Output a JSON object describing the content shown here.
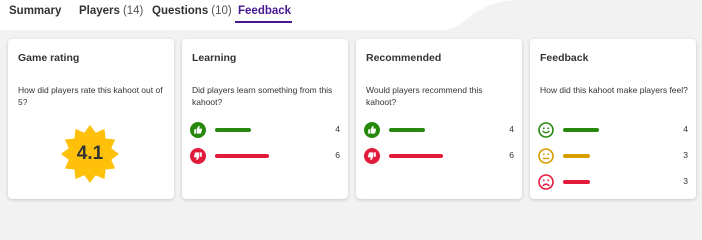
{
  "tabs": [
    {
      "label": "Summary",
      "count": ""
    },
    {
      "label": "Players",
      "count": "(14)"
    },
    {
      "label": "Questions",
      "count": "(10)"
    },
    {
      "label": "Feedback",
      "count": ""
    }
  ],
  "colors": {
    "accent": "#46178f",
    "positive": "#26890c",
    "negative": "#e21b3c",
    "neutral": "#d89e00",
    "star": "#ffc00a"
  },
  "cards": {
    "rating": {
      "title": "Game rating",
      "question": "How did players rate this kahoot out of 5?",
      "value": "4.1",
      "icon": "star-badge-icon"
    },
    "learning": {
      "title": "Learning",
      "question": "Did players learn something from this kahoot?",
      "rows": [
        {
          "icon": "thumbs-up-icon",
          "count": "4",
          "fraction": 0.4
        },
        {
          "icon": "thumbs-down-icon",
          "count": "6",
          "fraction": 0.6
        }
      ]
    },
    "recommended": {
      "title": "Recommended",
      "question": "Would players recommend this kahoot?",
      "rows": [
        {
          "icon": "thumbs-up-icon",
          "count": "4",
          "fraction": 0.4
        },
        {
          "icon": "thumbs-down-icon",
          "count": "6",
          "fraction": 0.6
        }
      ]
    },
    "feedback": {
      "title": "Feedback",
      "question": "How did this kahoot make players feel?",
      "rows": [
        {
          "icon": "happy-face-icon",
          "count": "4",
          "fraction": 0.4
        },
        {
          "icon": "neutral-face-icon",
          "count": "3",
          "fraction": 0.3
        },
        {
          "icon": "sad-face-icon",
          "count": "3",
          "fraction": 0.3
        }
      ]
    }
  }
}
